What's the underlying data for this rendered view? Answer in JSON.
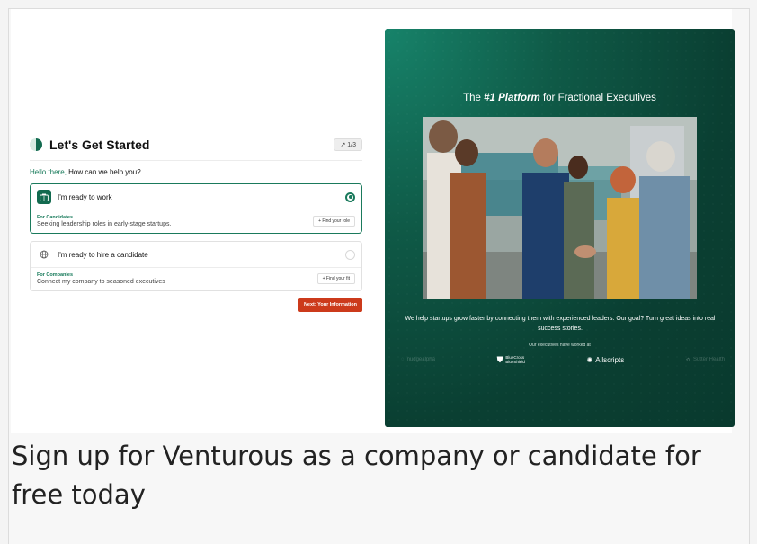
{
  "form": {
    "title": "Let's Get Started",
    "step": "1/3",
    "greeting_hello": "Hello there,",
    "greeting_question": "How can we help you?",
    "options": [
      {
        "label": "I'm ready to work",
        "subtitle": "For Candidates",
        "description": "Seeking leadership roles in early-stage startups.",
        "action": "Find your role",
        "selected": true,
        "icon": "briefcase-icon"
      },
      {
        "label": "I'm ready to hire a candidate",
        "subtitle": "For Companies",
        "description": "Connect my company to seasoned executives",
        "action": "Find your fit",
        "selected": false,
        "icon": "globe-icon"
      }
    ],
    "next_label": "Next: Your Information"
  },
  "panel": {
    "title_prefix": "The ",
    "title_emphasis": "#1 Platform",
    "title_suffix": " for Fractional Executives",
    "tagline": "We help startups grow faster by connecting them with experienced leaders. Our goal? Turn great ideas into real success stories.",
    "worked_at": "Our executives have worked at",
    "logos": {
      "l1": "nudgealpha",
      "l2_line1": "BlueCross",
      "l2_line2": "BlueShield",
      "l3": "Allscripts",
      "l4": "Sutter Health"
    }
  },
  "caption": "Sign up for Venturous as a company or candidate for free today",
  "colors": {
    "brand_green": "#126a4f",
    "accent_red": "#cc3a1b"
  }
}
